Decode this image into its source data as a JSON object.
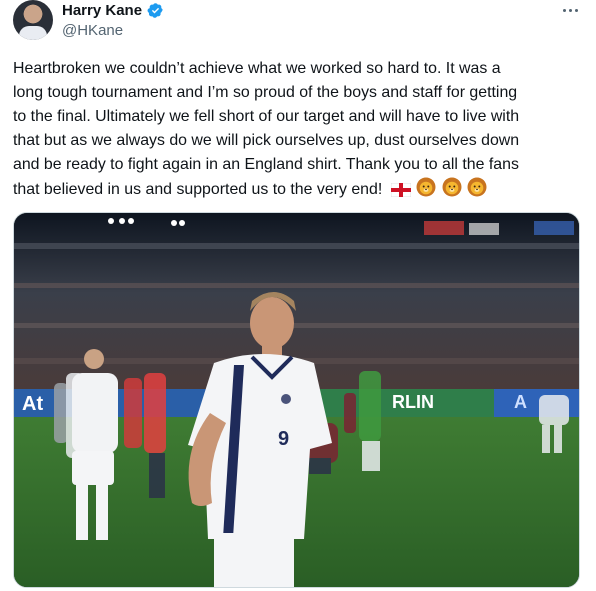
{
  "author": {
    "display_name": "Harry Kane",
    "handle": "@HKane",
    "verified": true
  },
  "post": {
    "lines": [
      "Heartbroken we couldn’t achieve what we worked so hard to. It was a",
      "long tough tournament and I’m so proud of the boys and staff for getting",
      "to the final. Ultimately we fell short of our target and will have to live with",
      "that but as we always do we will pick ourselves up, dust ourselves down",
      "and be ready to fight again in an England shirt. Thank you to all the fans",
      "that believed in us and supported us to the very end!"
    ],
    "emojis": [
      "england-flag-emoji",
      "lion-face-emoji",
      "lion-face-emoji",
      "lion-face-emoji"
    ]
  },
  "media": {
    "shirt_number": "9",
    "board_text_left": "At",
    "board_text_mid": "RLIN",
    "board_text_right": "A"
  },
  "colors": {
    "verified_blue": "#1d9bf0",
    "text_primary": "#0f1419",
    "text_secondary": "#536471",
    "pitch_green": "#2f6a2a",
    "board_blue": "#2a5fa8"
  },
  "icons": [
    "verified-badge-icon",
    "more-options-icon"
  ]
}
